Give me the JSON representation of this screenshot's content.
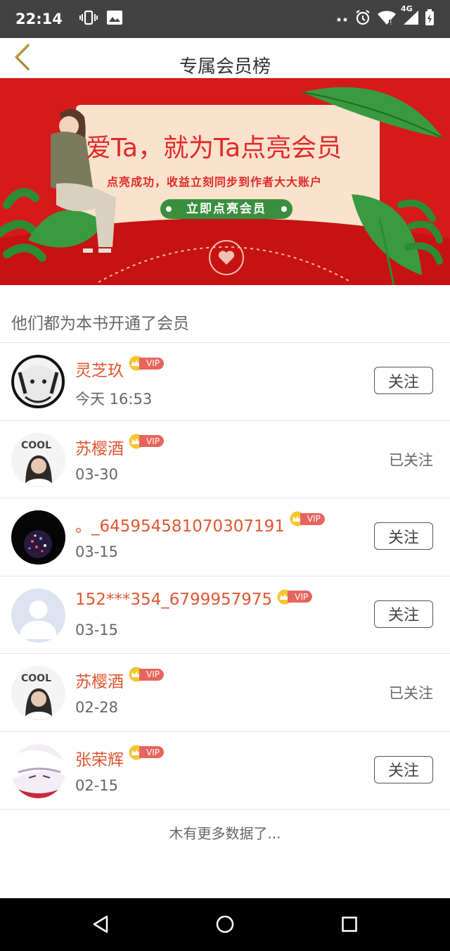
{
  "status_bar": {
    "time": "22:14",
    "network": "4G",
    "icons": [
      "vibrate-icon",
      "image-icon",
      "dots-icon",
      "alarm-icon",
      "wifi-icon",
      "signal-icon",
      "battery-icon"
    ]
  },
  "header": {
    "title": "专属会员榜",
    "back_icon": "chevron-left-icon"
  },
  "banner": {
    "headline": "爱Ta，就为Ta点亮会员",
    "subtitle": "点亮成功，收益立刻同步到作者大大账户",
    "cta": "立即点亮会员"
  },
  "section_label": "他们都为本书开通了会员",
  "members": [
    {
      "name": "灵芝玖",
      "vip_label": "VIP",
      "date": "今天 16:53",
      "action": "关注",
      "following": false
    },
    {
      "name": "苏樱酒",
      "vip_label": "VIP",
      "date": "03-30",
      "action": "已关注",
      "following": true
    },
    {
      "name": "。_645954581070307191",
      "vip_label": "VIP",
      "date": "03-15",
      "action": "关注",
      "following": false
    },
    {
      "name": "152***354_6799957975",
      "vip_label": "VIP",
      "date": "03-15",
      "action": "关注",
      "following": false
    },
    {
      "name": "苏樱酒",
      "vip_label": "VIP",
      "date": "02-28",
      "action": "已关注",
      "following": true
    },
    {
      "name": "张荣辉",
      "vip_label": "VIP",
      "date": "02-15",
      "action": "关注",
      "following": false
    }
  ],
  "footer_text": "木有更多数据了...",
  "colors": {
    "accent": "#e0562f",
    "banner_red": "#d61a1a",
    "vip_tag": "#e7655d",
    "cta_green": "#3a8f3f",
    "header_chevron": "#c9a83c"
  }
}
